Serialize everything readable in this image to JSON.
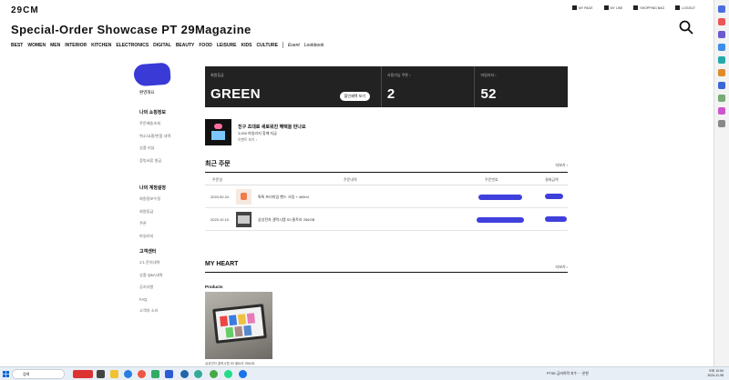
{
  "site": {
    "logo": "29CM",
    "headline": "Special-Order Showcase PT 29Magazine"
  },
  "utility": [
    {
      "label": "MY PAGE",
      "icon": "user-icon"
    },
    {
      "label": "MY LIKE",
      "icon": "heart-icon"
    },
    {
      "label": "SHOPPING BAG",
      "icon": "bag-icon"
    },
    {
      "label": "LOGOUT",
      "icon": "logout-icon"
    }
  ],
  "gnb": {
    "main": [
      "BEST",
      "WOMEN",
      "MEN",
      "INTERIOR",
      "KITCHEN",
      "ELECTRONICS",
      "DIGITAL",
      "BEAUTY",
      "FOOD",
      "LEISURE",
      "KIDS",
      "CULTURE"
    ],
    "extra": [
      "Event",
      "Lookbook"
    ]
  },
  "sidebar": {
    "greeting": "환영해요",
    "groups": [
      {
        "title": "나의 쇼핑정보",
        "items": [
          "주문배송조회",
          "취소/교환/반품 내역",
          "상품 리뷰",
          "증빙서류 발급"
        ]
      },
      {
        "title": "나의 계정설정",
        "items": [
          "회원정보수정",
          "회원등급",
          "쿠폰",
          "마일리지"
        ]
      },
      {
        "title": "고객센터",
        "items": [
          "1:1 문의내역",
          "상품 Q&A내역",
          "공지사항",
          "FAQ",
          "고객의 소리"
        ]
      }
    ]
  },
  "summary": {
    "grade_label": "회원등급",
    "grade_value": "GREEN",
    "grade_button": "할인혜택 보기",
    "coupon_label": "사용가능 쿠폰 ›",
    "coupon_value": "2",
    "mileage_label": "마일리지 ›",
    "mileage_value": "52"
  },
  "invite": {
    "title": "친구 초대로 새로워진 혜택을 만나요",
    "subtitle": "3,000 마일리지 함께 지급",
    "link": "이벤트 보기 ›"
  },
  "recent_orders": {
    "title": "최근 주문",
    "more": "더보기 ›",
    "columns": [
      "주문일",
      "주문내역",
      "주문번호",
      "결제금액"
    ],
    "rows": [
      {
        "date": "2024.00.24",
        "product": "톡톡 프리미엄 핸드 크림 + 400ml"
      },
      {
        "date": "2023.10.10",
        "product": "삼성전자 갤럭시탭 S9 울트라 256GB"
      }
    ]
  },
  "my_heart": {
    "title": "MY HEART",
    "more": "더보기 ›",
    "products_label": "Products",
    "product_caption": "삼성전자 갤럭시탭 S9 울트라 256GB"
  },
  "taskbar": {
    "search_placeholder": "검색",
    "tray_time": "오후 10:54",
    "tray_date": "2024-11-08",
    "right_text": "PTSE 금리하락 지수 ··· 온한"
  },
  "colors": {
    "summary_bg": "#222222",
    "scribble": "#3f3fdc"
  }
}
